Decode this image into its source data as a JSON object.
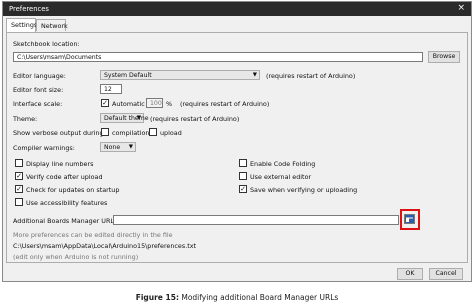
{
  "window": {
    "title": "Preferences",
    "close_glyph": "×"
  },
  "tabs": [
    {
      "label": "Settings"
    },
    {
      "label": "Network"
    }
  ],
  "settings": {
    "sketchbook_label": "Sketchbook location:",
    "sketchbook_value": "C:\\Users\\msam\\Documents",
    "browse_label": "Browse",
    "editor_language_label": "Editor language:",
    "editor_language_value": "System Default",
    "editor_language_note": "(requires restart of Arduino)",
    "font_size_label": "Editor font size:",
    "font_size_value": "12",
    "interface_scale_label": "Interface scale:",
    "automatic_label": "Automatic",
    "scale_value": "100",
    "scale_unit": "%",
    "scale_note": "(requires restart of Arduino)",
    "theme_label": "Theme:",
    "theme_value": "Default theme",
    "theme_note": "(requires restart of Arduino)",
    "verbose_label": "Show verbose output during:",
    "compilation_label": "compilation",
    "upload_label": "upload",
    "compiler_warnings_label": "Compiler warnings:",
    "compiler_warnings_value": "None",
    "display_line_numbers": "Display line numbers",
    "enable_code_folding": "Enable Code Folding",
    "verify_after_upload": "Verify code after upload",
    "use_external_editor": "Use external editor",
    "check_updates": "Check for updates on startup",
    "save_when_verifying": "Save when verifying or uploading",
    "use_accessibility": "Use accessibility features",
    "boards_url_label": "Additional Boards Manager URLs:",
    "boards_url_value": "",
    "more_prefs": "More preferences can be edited directly in the file",
    "prefs_path": "C:\\Users\\msam\\AppData\\Local\\Arduino15\\preferences.txt",
    "edit_note": "(edit only when Arduino is not running)"
  },
  "checkboxes": {
    "automatic": true,
    "compilation": false,
    "upload": false,
    "display_line_numbers": false,
    "enable_code_folding": false,
    "verify_after_upload": true,
    "use_external_editor": false,
    "check_updates": true,
    "save_when_verifying": true,
    "use_accessibility": false
  },
  "check_glyph": "✓",
  "dropdown_glyph": "▼",
  "footer": {
    "ok_label": "OK",
    "cancel_label": "Cancel"
  },
  "caption": {
    "prefix": "Figure 15:",
    "text": "Modifying additional Board Manager URLs"
  },
  "icons": {
    "url_list_button": "window-list-icon"
  },
  "colors": {
    "titlebar": "#2b2b2b",
    "highlight": "#dd1111"
  }
}
